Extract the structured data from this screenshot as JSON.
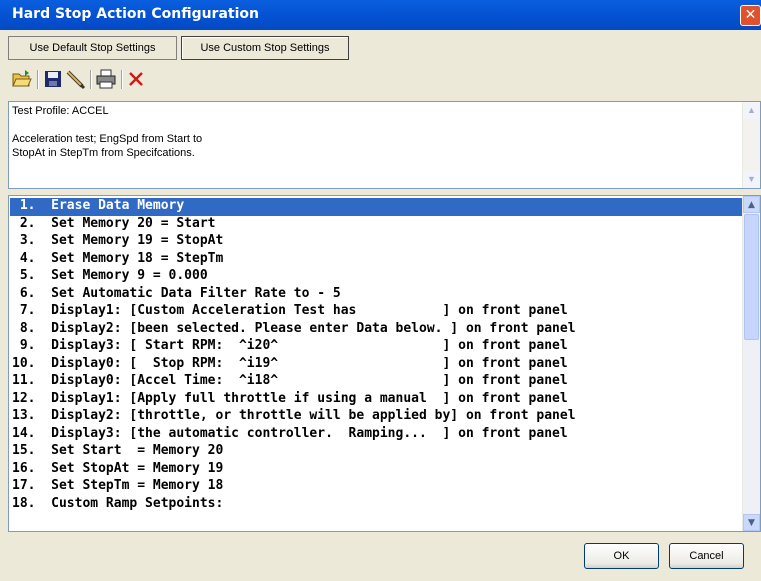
{
  "window": {
    "title": "Hard Stop Action Configuration",
    "close_glyph": "✕"
  },
  "tabs": [
    {
      "label": "Use Default Stop Settings"
    },
    {
      "label": "Use Custom Stop Settings",
      "active": true
    }
  ],
  "toolbar": {
    "buttons": [
      "open-folder-icon",
      "save-icon",
      "edit-pencil-icon",
      "print-icon",
      "delete-icon"
    ]
  },
  "description": {
    "text": "Test Profile: ACCEL\n\nAcceleration test; EngSpd from Start to\nStopAt in StepTm from Specifcations."
  },
  "steps": [
    " 1.  Erase Data Memory",
    " 2.  Set Memory 20 = Start",
    " 3.  Set Memory 19 = StopAt",
    " 4.  Set Memory 18 = StepTm",
    " 5.  Set Memory 9 = 0.000",
    " 6.  Set Automatic Data Filter Rate to - 5",
    " 7.  Display1: [Custom Acceleration Test has           ] on front panel",
    " 8.  Display2: [been selected. Please enter Data below. ] on front panel",
    " 9.  Display3: [ Start RPM:  ^i20^                     ] on front panel",
    "10.  Display0: [  Stop RPM:  ^i19^                     ] on front panel",
    "11.  Display0: [Accel Time:  ^i18^                     ] on front panel",
    "12.  Display1: [Apply full throttle if using a manual  ] on front panel",
    "13.  Display2: [throttle, or throttle will be applied by] on front panel",
    "14.  Display3: [the automatic controller.  Ramping...  ] on front panel",
    "15.  Set Start  = Memory 20",
    "16.  Set StopAt = Memory 19",
    "17.  Set StepTm = Memory 18",
    "18.  Custom Ramp Setpoints:"
  ],
  "selected_step": 0,
  "buttons": {
    "ok": "OK",
    "cancel": "Cancel"
  },
  "colors": {
    "title_bar": "#0555d6",
    "selection": "#316ac5",
    "background": "#ece9d8"
  }
}
